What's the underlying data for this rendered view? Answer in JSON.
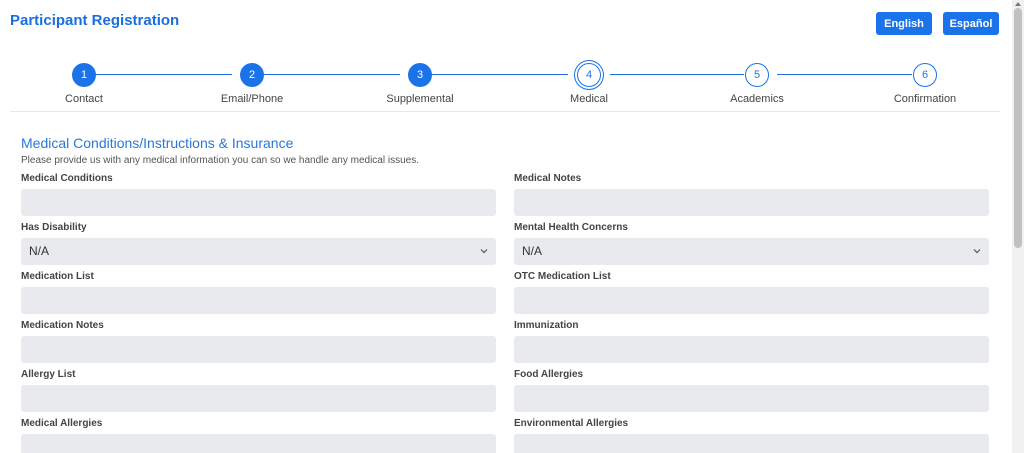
{
  "header": {
    "title": "Participant Registration",
    "english_label": "English",
    "spanish_label": "Español"
  },
  "steps": [
    {
      "num": "1",
      "label": "Contact",
      "state": "done"
    },
    {
      "num": "2",
      "label": "Email/Phone",
      "state": "done"
    },
    {
      "num": "3",
      "label": "Supplemental",
      "state": "done"
    },
    {
      "num": "4",
      "label": "Medical",
      "state": "current"
    },
    {
      "num": "5",
      "label": "Academics",
      "state": "todo"
    },
    {
      "num": "6",
      "label": "Confirmation",
      "state": "todo"
    }
  ],
  "section": {
    "title": "Medical Conditions/Instructions & Insurance",
    "subtitle": "Please provide us with any medical information you can so we handle any medical issues."
  },
  "fields": {
    "medical_conditions": {
      "label": "Medical Conditions",
      "value": ""
    },
    "medical_notes": {
      "label": "Medical Notes",
      "value": ""
    },
    "has_disability": {
      "label": "Has Disability",
      "value": "N/A"
    },
    "mental_health": {
      "label": "Mental Health Concerns",
      "value": "N/A"
    },
    "medication_list": {
      "label": "Medication List",
      "value": ""
    },
    "otc_medication": {
      "label": "OTC Medication List",
      "value": ""
    },
    "medication_notes": {
      "label": "Medication Notes",
      "value": ""
    },
    "immunization": {
      "label": "Immunization",
      "value": ""
    },
    "allergy_list": {
      "label": "Allergy List",
      "value": ""
    },
    "food_allergies": {
      "label": "Food Allergies",
      "value": ""
    },
    "medical_allergies": {
      "label": "Medical Allergies",
      "value": ""
    },
    "environmental_allergies": {
      "label": "Environmental Allergies",
      "value": ""
    }
  },
  "colors": {
    "accent": "#1a73e8",
    "input_bg": "#e8eaed"
  }
}
